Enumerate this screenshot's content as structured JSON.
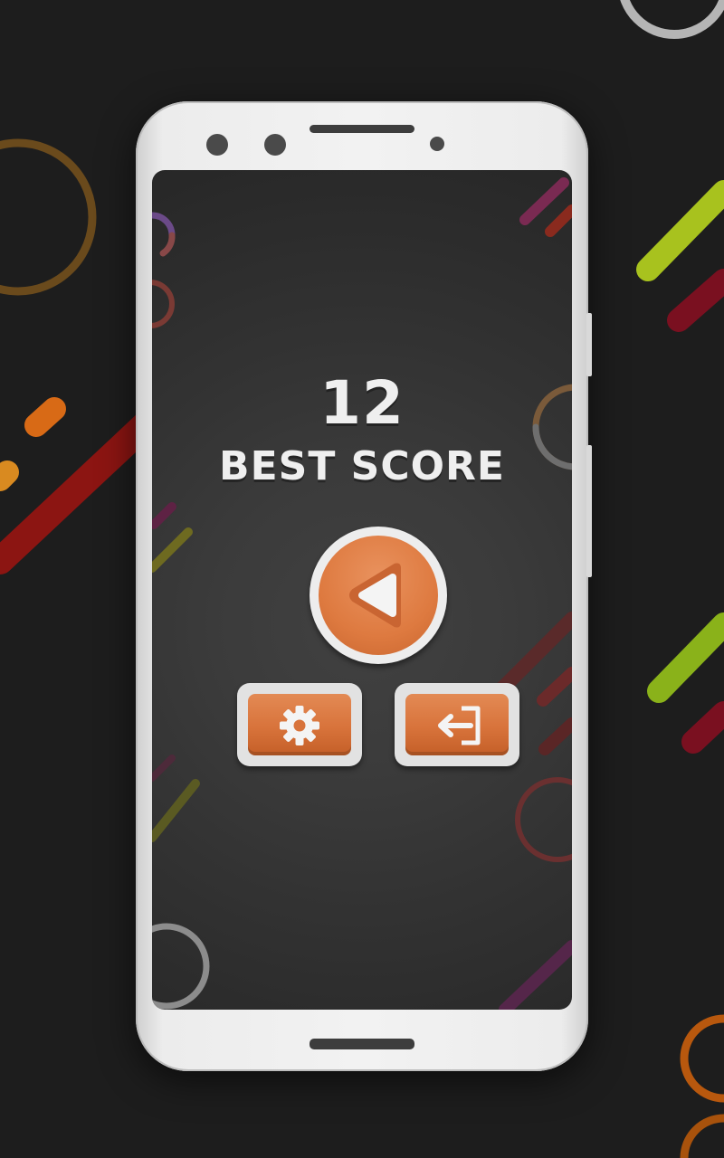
{
  "game": {
    "score": "12",
    "best_score_label": "BEST SCORE"
  },
  "buttons": {
    "play": {
      "icon": "play-triangle-icon"
    },
    "settings": {
      "icon": "gear-icon"
    },
    "exit": {
      "icon": "exit-door-icon"
    }
  },
  "colors": {
    "accent_orange": "#de7a40",
    "button_frame": "#ededed",
    "text": "#efefef",
    "background": "#1d1d1d"
  }
}
